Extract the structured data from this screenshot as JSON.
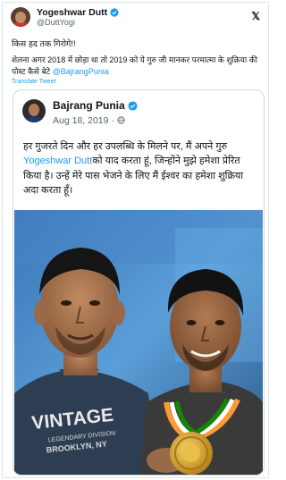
{
  "tweet": {
    "author_name": "Yogeshwar Dutt",
    "author_handle": "@DuttYogi",
    "line1": "किस हद तक गिरोगे!!",
    "text_before_mention": "शेलना अगर 2018 में छोड़ा था तो 2019 को ये गुरु जी मानकर परमात्मा के शुक्रिया की पोस्ट कैसे बेटे ",
    "mention": "@BajrangPunia",
    "translate_label": "Translate Tweet"
  },
  "quoted": {
    "author_name": "Bajrang Punia",
    "date": "Aug 18, 2019 · ",
    "text_part1": "हर गुजरते दिन और हर उपलब्धि के मिलने पर, मैं अपने गुरु ",
    "link_text": "Yogeshwar Dutt",
    "text_part2": "को याद करता हूं, जिन्होंने मुझे हमेशा प्रेरित किया है। उन्हें मेरे पास भेजने के लिए मैं ईश्वर का हमेशा शुक्रिया अदा करता हूँ।",
    "photo_print_line1": "VINTAGE",
    "photo_print_line2": "LEGENDARY DIVISION",
    "photo_print_line3": "BROOKLYN, NY"
  },
  "colors": {
    "accent": "#1d9bf0",
    "verified": "#1d9bf0",
    "text": "#0f1419",
    "muted": "#536471"
  },
  "icons": {
    "verified": "verified-badge-icon",
    "platform": "x-logo-icon",
    "globe": "globe-icon"
  }
}
